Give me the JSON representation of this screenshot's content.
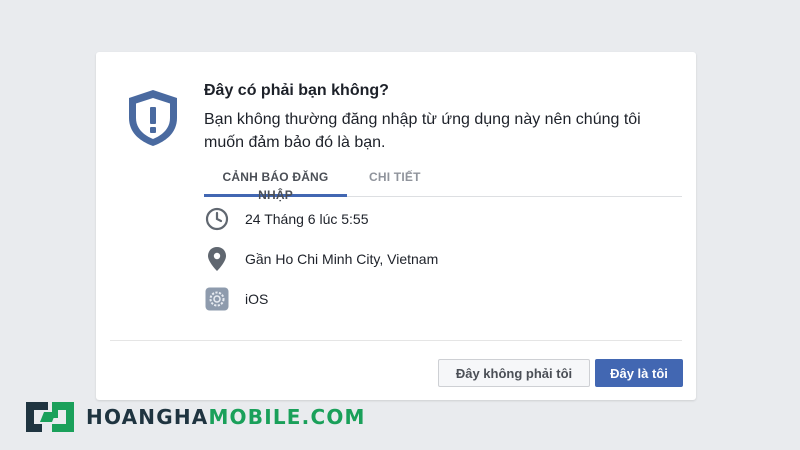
{
  "dialog": {
    "title": "Đây có phải bạn không?",
    "description": "Bạn không thường đăng nhập từ ứng dụng này nên chúng tôi muốn đảm bảo đó là bạn.",
    "tabs": [
      {
        "label": "CẢNH BÁO ĐĂNG NHẬP",
        "active": true
      },
      {
        "label": "CHI TIẾT",
        "active": false
      }
    ],
    "details": [
      {
        "icon": "clock-icon",
        "text": "24 Tháng 6 lúc 5:55"
      },
      {
        "icon": "location-pin-icon",
        "text": "Gần Ho Chi Minh City, Vietnam"
      },
      {
        "icon": "ios-settings-icon",
        "text": "iOS"
      }
    ],
    "buttons": {
      "not_me": "Đây không phải tôi",
      "is_me": "Đây là tôi"
    }
  },
  "watermark": {
    "text_part1": "HOANGHA",
    "text_part2": "MOBILE.COM"
  },
  "colors": {
    "primary": "#4267b2",
    "shield": "#4a6aa0",
    "background": "#e9ebee",
    "logo_dark": "#1f3440",
    "logo_green": "#1aa05a"
  }
}
